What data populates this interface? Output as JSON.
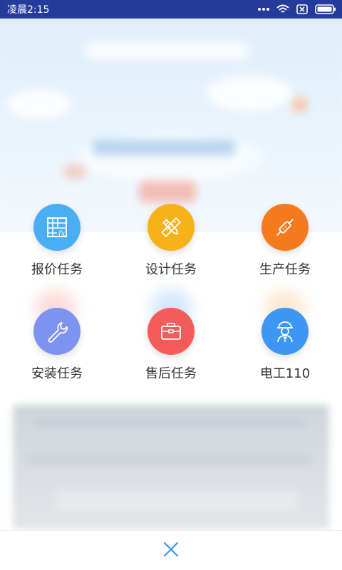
{
  "status_bar": {
    "time": "凌晨2:15",
    "icons": [
      "more-dots-icon",
      "wifi-icon",
      "sim-icon",
      "battery-icon"
    ]
  },
  "menu": {
    "items": [
      {
        "label": "报价任务",
        "icon": "spreadsheet-formula-icon",
        "color": "#4aaef5"
      },
      {
        "label": "设计任务",
        "icon": "pencil-ruler-icon",
        "color": "#f7b219"
      },
      {
        "label": "生产任务",
        "icon": "fuse-icon",
        "color": "#f57a1e"
      },
      {
        "label": "安装任务",
        "icon": "wrench-icon",
        "color": "#7e93ef"
      },
      {
        "label": "售后任务",
        "icon": "briefcase-icon",
        "color": "#f45c5c"
      },
      {
        "label": "电工110",
        "icon": "electrician-icon",
        "color": "#3d96f3"
      }
    ]
  },
  "close": {
    "icon": "close-icon",
    "color": "#3d96f3"
  }
}
